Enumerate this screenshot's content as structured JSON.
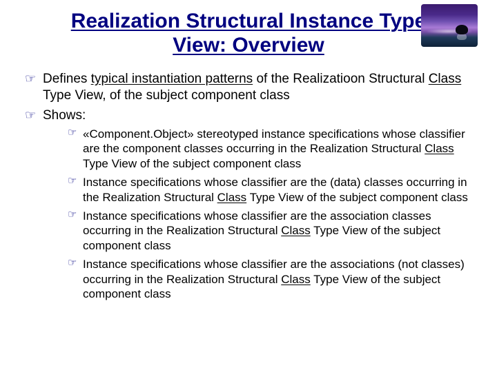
{
  "title_line1": "Realization Structural Instance Type",
  "title_line2": "View: Overview",
  "bullets": {
    "b1_a": "Defines ",
    "b1_u": "typical instantiation patterns",
    "b1_b": " of the Realizatioon Structural ",
    "b1_u2": "Class",
    "b1_c": " Type View, of the subject component class",
    "b2": "Shows:"
  },
  "sub": {
    "s1_a": "«Component.Object» stereotyped instance specifications whose classifier are the component classes occurring in the Realization Structural ",
    "s1_u": "Class",
    "s1_b": " Type View of the subject component class",
    "s2_a": "Instance specifications whose classifier are the (data) classes occurring in the Realization Structural ",
    "s2_u": "Class",
    "s2_b": " Type View of the subject component class",
    "s3_a": "Instance specifications whose classifier are the association classes occurring in the Realization Structural ",
    "s3_u": "Class",
    "s3_b": " Type View of the subject component class",
    "s4_a": "Instance specifications whose classifier are the associations (not classes) occurring in the Realization Structural ",
    "s4_u": "Class",
    "s4_b": " Type View of the subject component class"
  }
}
